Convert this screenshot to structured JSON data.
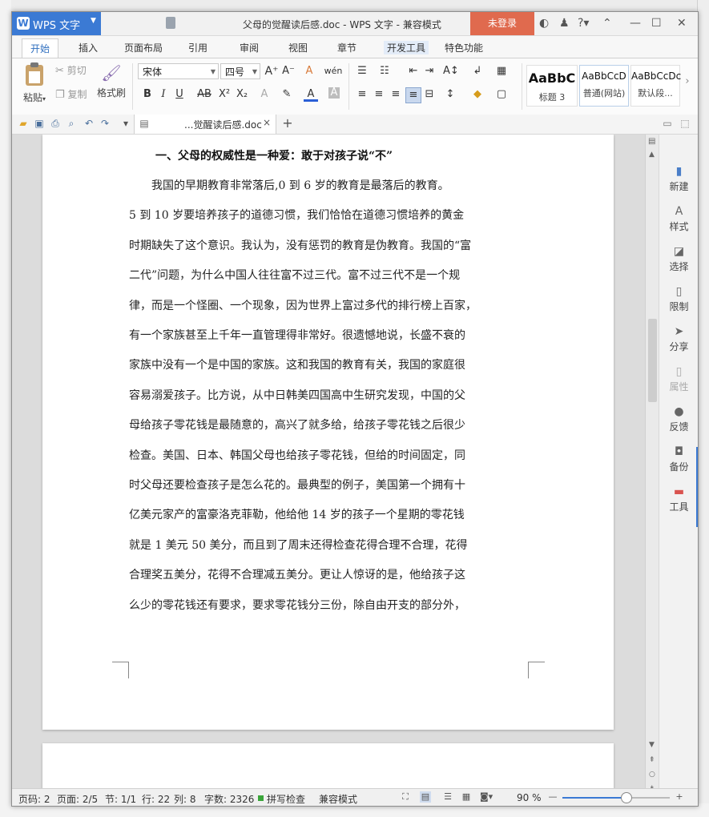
{
  "app": {
    "name": "WPS 文字",
    "window_title": "父母的觉醒读后感.doc - WPS 文字 - 兼容模式",
    "login_label": "未登录"
  },
  "ribbon_tabs": [
    "开始",
    "插入",
    "页面布局",
    "引用",
    "审阅",
    "视图",
    "章节",
    "开发工具",
    "特色功能"
  ],
  "ribbon": {
    "paste": "粘贴",
    "cut": "剪切",
    "copy": "复制",
    "format_painter": "格式刷",
    "font_name": "宋体",
    "font_size": "四号",
    "styles": [
      {
        "preview": "AaBbC",
        "name": "标题 3"
      },
      {
        "preview": "AaBbCcD",
        "name": "普通(网站)"
      },
      {
        "preview": "AaBbCcDc",
        "name": "默认段..."
      }
    ]
  },
  "doc_tab": {
    "name": "...觉醒读后感.doc",
    "close": "×",
    "add": "+"
  },
  "document": {
    "heading": "一、父母的权威性是一种爱：敢于对孩子说“不”",
    "lines": [
      "　　我国的早期教育非常落后,0 到 6 岁的教育是最落后的教育。",
      "5 到 10 岁要培养孩子的道德习惯，我们恰恰在道德习惯培养的黄金",
      "时期缺失了这个意识。我认为，没有惩罚的教育是伪教育。我国的“富",
      "二代”问题，为什么中国人往往富不过三代。富不过三代不是一个规",
      "律，而是一个怪圈、一个现象，因为世界上富过多代的排行榜上百家，",
      "有一个家族甚至上千年一直管理得非常好。很遗憾地说，长盛不衰的",
      "家族中没有一个是中国的家族。这和我国的教育有关，我国的家庭很",
      "容易溺爱孩子。比方说，从中日韩美四国高中生研究发现，中国的父",
      "母给孩子零花钱是最随意的，高兴了就多给，给孩子零花钱之后很少",
      "检查。美国、日本、韩国父母也给孩子零花钱，但给的时间固定，同",
      "时父母还要检查孩子是怎么花的。最典型的例子，美国第一个拥有十",
      "亿美元家产的富豪洛克菲勒，他给他 14 岁的孩子一个星期的零花钱",
      "就是 1 美元 50 美分，而且到了周末还得检查花得合理不合理，花得",
      "合理奖五美分，花得不合理减五美分。更让人惊讶的是，他给孩子这",
      "么少的零花钱还有要求，要求零花钱分三份，除自由开支的部分外，"
    ]
  },
  "task_pane": [
    "新建",
    "样式",
    "选择",
    "限制",
    "分享",
    "属性",
    "反馈",
    "备份",
    "工具"
  ],
  "status_bar": {
    "page_no": "页码: 2",
    "pages": "页面: 2/5",
    "section": "节: 1/1",
    "row": "行: 22",
    "col": "列: 8",
    "words": "字数: 2326",
    "spell": "拼写检查",
    "compat": "兼容模式",
    "zoom": "90 %",
    "zoom_level": 0.59
  }
}
